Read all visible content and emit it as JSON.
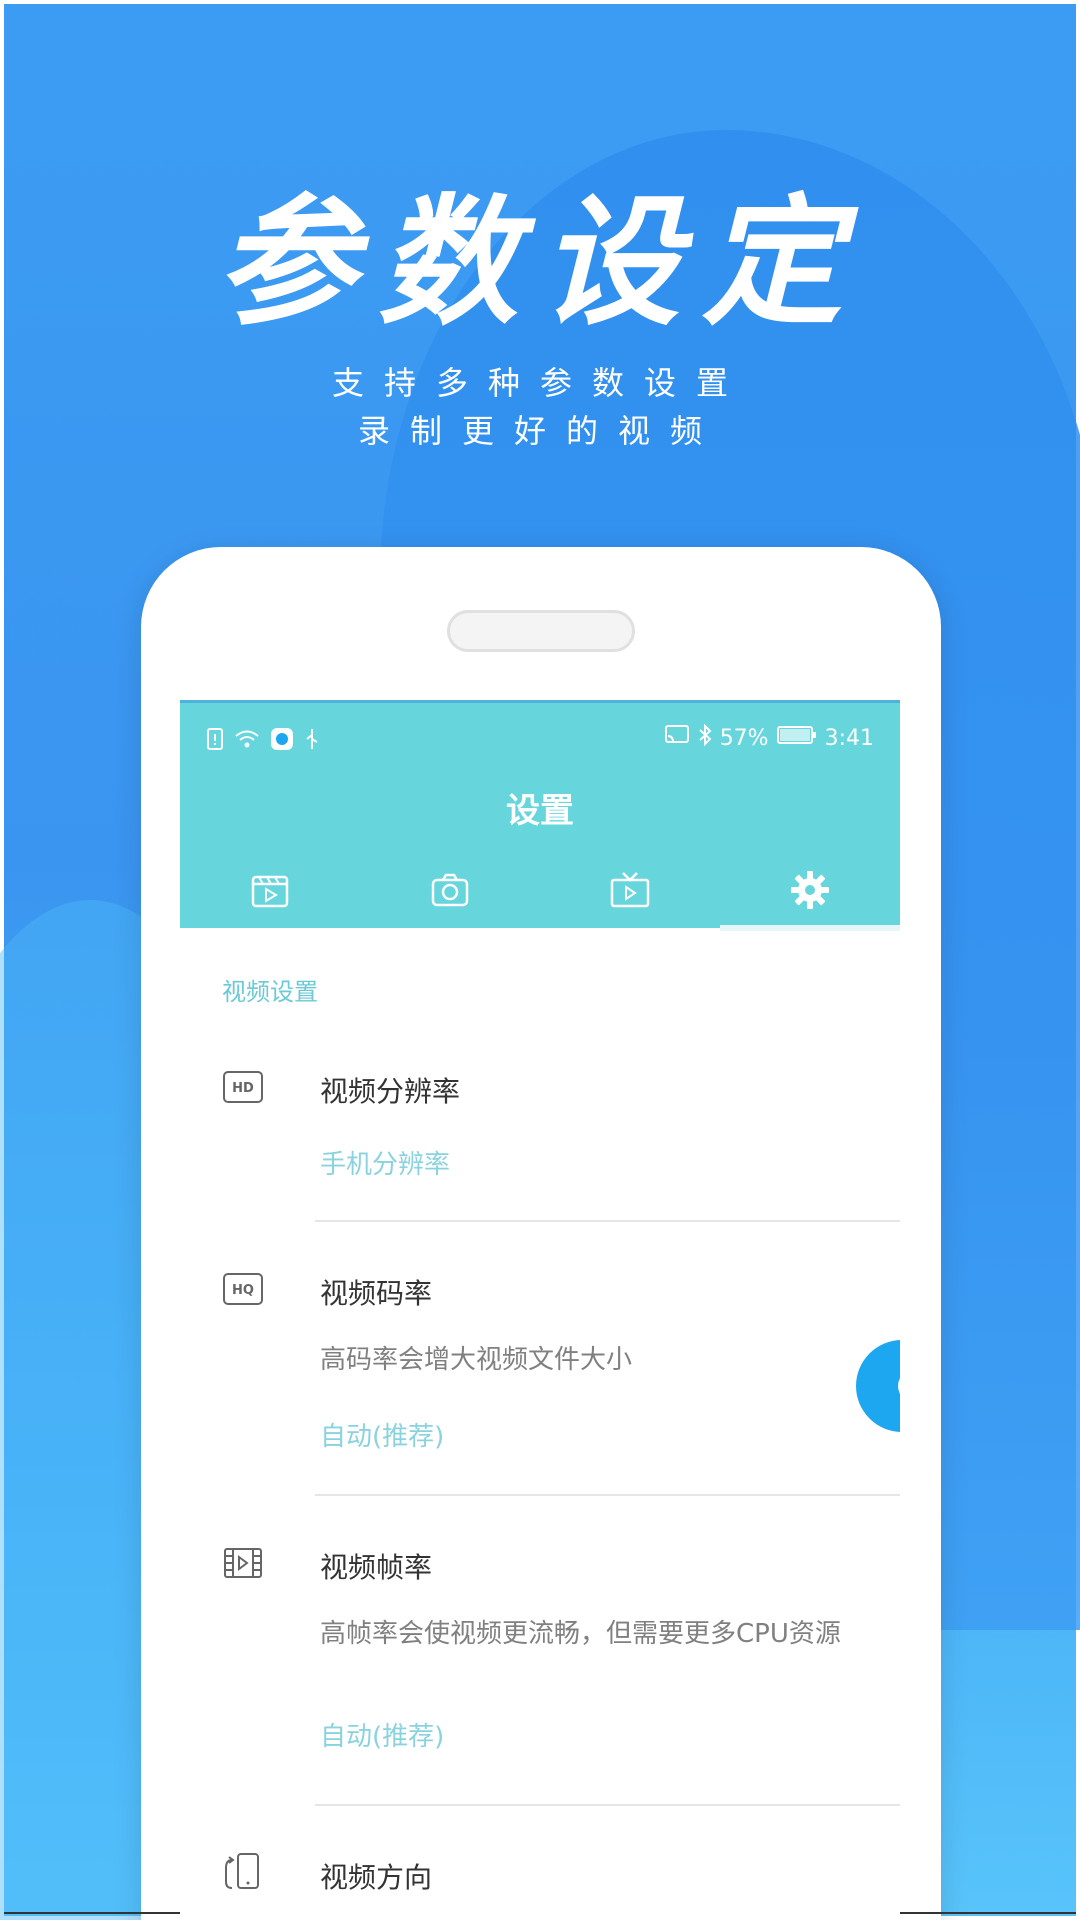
{
  "hero": {
    "title": "参数设定",
    "subtitle_line1": "支持多种参数设置",
    "subtitle_line2": "录制更好的视频"
  },
  "status_bar": {
    "battery": "57%",
    "time": "3:41"
  },
  "app": {
    "title": "设置",
    "tabs": [
      {
        "icon": "film-clapper-icon"
      },
      {
        "icon": "camera-icon"
      },
      {
        "icon": "tv-play-icon"
      },
      {
        "icon": "gear-icon",
        "active": true
      }
    ],
    "section_label": "视频设置",
    "settings": [
      {
        "icon": "hd-icon",
        "icon_text": "HD",
        "title": "视频分辨率",
        "value": "手机分辨率"
      },
      {
        "icon": "hq-icon",
        "icon_text": "HQ",
        "title": "视频码率",
        "description": "高码率会增大视频文件大小",
        "value": "自动(推荐)"
      },
      {
        "icon": "film-frame-icon",
        "title": "视频帧率",
        "description": "高帧率会使视频更流畅，但需要更多CPU资源",
        "value": "自动(推荐)"
      },
      {
        "icon": "phone-rotate-icon",
        "title": "视频方向"
      }
    ]
  },
  "colors": {
    "background": "#3c9cf3",
    "appbar": "#66d6dc",
    "accent_text": "#8ad3de",
    "fab": "#1ea7f1"
  }
}
